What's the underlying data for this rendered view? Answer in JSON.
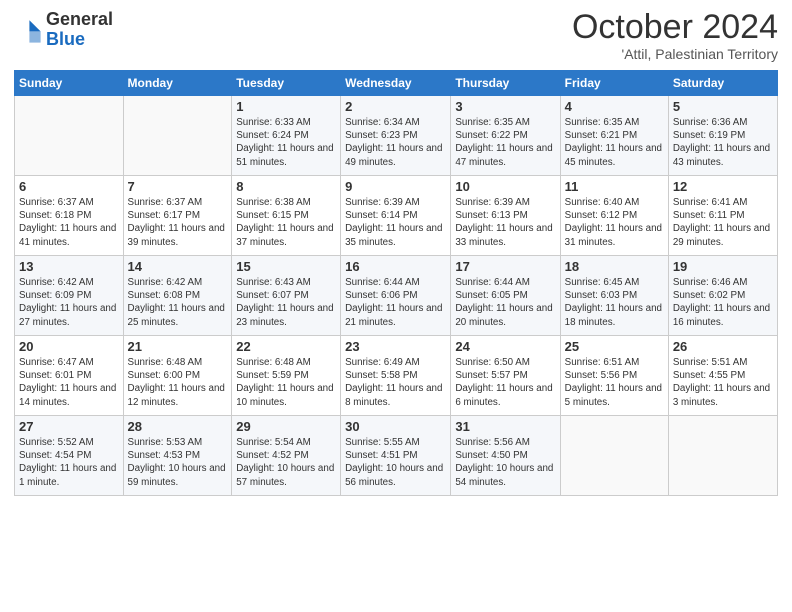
{
  "logo": {
    "general": "General",
    "blue": "Blue"
  },
  "header": {
    "month": "October 2024",
    "location": "'Attil, Palestinian Territory"
  },
  "weekdays": [
    "Sunday",
    "Monday",
    "Tuesday",
    "Wednesday",
    "Thursday",
    "Friday",
    "Saturday"
  ],
  "weeks": [
    [
      {
        "day": "",
        "info": ""
      },
      {
        "day": "",
        "info": ""
      },
      {
        "day": "1",
        "info": "Sunrise: 6:33 AM\nSunset: 6:24 PM\nDaylight: 11 hours and 51 minutes."
      },
      {
        "day": "2",
        "info": "Sunrise: 6:34 AM\nSunset: 6:23 PM\nDaylight: 11 hours and 49 minutes."
      },
      {
        "day": "3",
        "info": "Sunrise: 6:35 AM\nSunset: 6:22 PM\nDaylight: 11 hours and 47 minutes."
      },
      {
        "day": "4",
        "info": "Sunrise: 6:35 AM\nSunset: 6:21 PM\nDaylight: 11 hours and 45 minutes."
      },
      {
        "day": "5",
        "info": "Sunrise: 6:36 AM\nSunset: 6:19 PM\nDaylight: 11 hours and 43 minutes."
      }
    ],
    [
      {
        "day": "6",
        "info": "Sunrise: 6:37 AM\nSunset: 6:18 PM\nDaylight: 11 hours and 41 minutes."
      },
      {
        "day": "7",
        "info": "Sunrise: 6:37 AM\nSunset: 6:17 PM\nDaylight: 11 hours and 39 minutes."
      },
      {
        "day": "8",
        "info": "Sunrise: 6:38 AM\nSunset: 6:15 PM\nDaylight: 11 hours and 37 minutes."
      },
      {
        "day": "9",
        "info": "Sunrise: 6:39 AM\nSunset: 6:14 PM\nDaylight: 11 hours and 35 minutes."
      },
      {
        "day": "10",
        "info": "Sunrise: 6:39 AM\nSunset: 6:13 PM\nDaylight: 11 hours and 33 minutes."
      },
      {
        "day": "11",
        "info": "Sunrise: 6:40 AM\nSunset: 6:12 PM\nDaylight: 11 hours and 31 minutes."
      },
      {
        "day": "12",
        "info": "Sunrise: 6:41 AM\nSunset: 6:11 PM\nDaylight: 11 hours and 29 minutes."
      }
    ],
    [
      {
        "day": "13",
        "info": "Sunrise: 6:42 AM\nSunset: 6:09 PM\nDaylight: 11 hours and 27 minutes."
      },
      {
        "day": "14",
        "info": "Sunrise: 6:42 AM\nSunset: 6:08 PM\nDaylight: 11 hours and 25 minutes."
      },
      {
        "day": "15",
        "info": "Sunrise: 6:43 AM\nSunset: 6:07 PM\nDaylight: 11 hours and 23 minutes."
      },
      {
        "day": "16",
        "info": "Sunrise: 6:44 AM\nSunset: 6:06 PM\nDaylight: 11 hours and 21 minutes."
      },
      {
        "day": "17",
        "info": "Sunrise: 6:44 AM\nSunset: 6:05 PM\nDaylight: 11 hours and 20 minutes."
      },
      {
        "day": "18",
        "info": "Sunrise: 6:45 AM\nSunset: 6:03 PM\nDaylight: 11 hours and 18 minutes."
      },
      {
        "day": "19",
        "info": "Sunrise: 6:46 AM\nSunset: 6:02 PM\nDaylight: 11 hours and 16 minutes."
      }
    ],
    [
      {
        "day": "20",
        "info": "Sunrise: 6:47 AM\nSunset: 6:01 PM\nDaylight: 11 hours and 14 minutes."
      },
      {
        "day": "21",
        "info": "Sunrise: 6:48 AM\nSunset: 6:00 PM\nDaylight: 11 hours and 12 minutes."
      },
      {
        "day": "22",
        "info": "Sunrise: 6:48 AM\nSunset: 5:59 PM\nDaylight: 11 hours and 10 minutes."
      },
      {
        "day": "23",
        "info": "Sunrise: 6:49 AM\nSunset: 5:58 PM\nDaylight: 11 hours and 8 minutes."
      },
      {
        "day": "24",
        "info": "Sunrise: 6:50 AM\nSunset: 5:57 PM\nDaylight: 11 hours and 6 minutes."
      },
      {
        "day": "25",
        "info": "Sunrise: 6:51 AM\nSunset: 5:56 PM\nDaylight: 11 hours and 5 minutes."
      },
      {
        "day": "26",
        "info": "Sunrise: 5:51 AM\nSunset: 4:55 PM\nDaylight: 11 hours and 3 minutes."
      }
    ],
    [
      {
        "day": "27",
        "info": "Sunrise: 5:52 AM\nSunset: 4:54 PM\nDaylight: 11 hours and 1 minute."
      },
      {
        "day": "28",
        "info": "Sunrise: 5:53 AM\nSunset: 4:53 PM\nDaylight: 10 hours and 59 minutes."
      },
      {
        "day": "29",
        "info": "Sunrise: 5:54 AM\nSunset: 4:52 PM\nDaylight: 10 hours and 57 minutes."
      },
      {
        "day": "30",
        "info": "Sunrise: 5:55 AM\nSunset: 4:51 PM\nDaylight: 10 hours and 56 minutes."
      },
      {
        "day": "31",
        "info": "Sunrise: 5:56 AM\nSunset: 4:50 PM\nDaylight: 10 hours and 54 minutes."
      },
      {
        "day": "",
        "info": ""
      },
      {
        "day": "",
        "info": ""
      }
    ]
  ]
}
